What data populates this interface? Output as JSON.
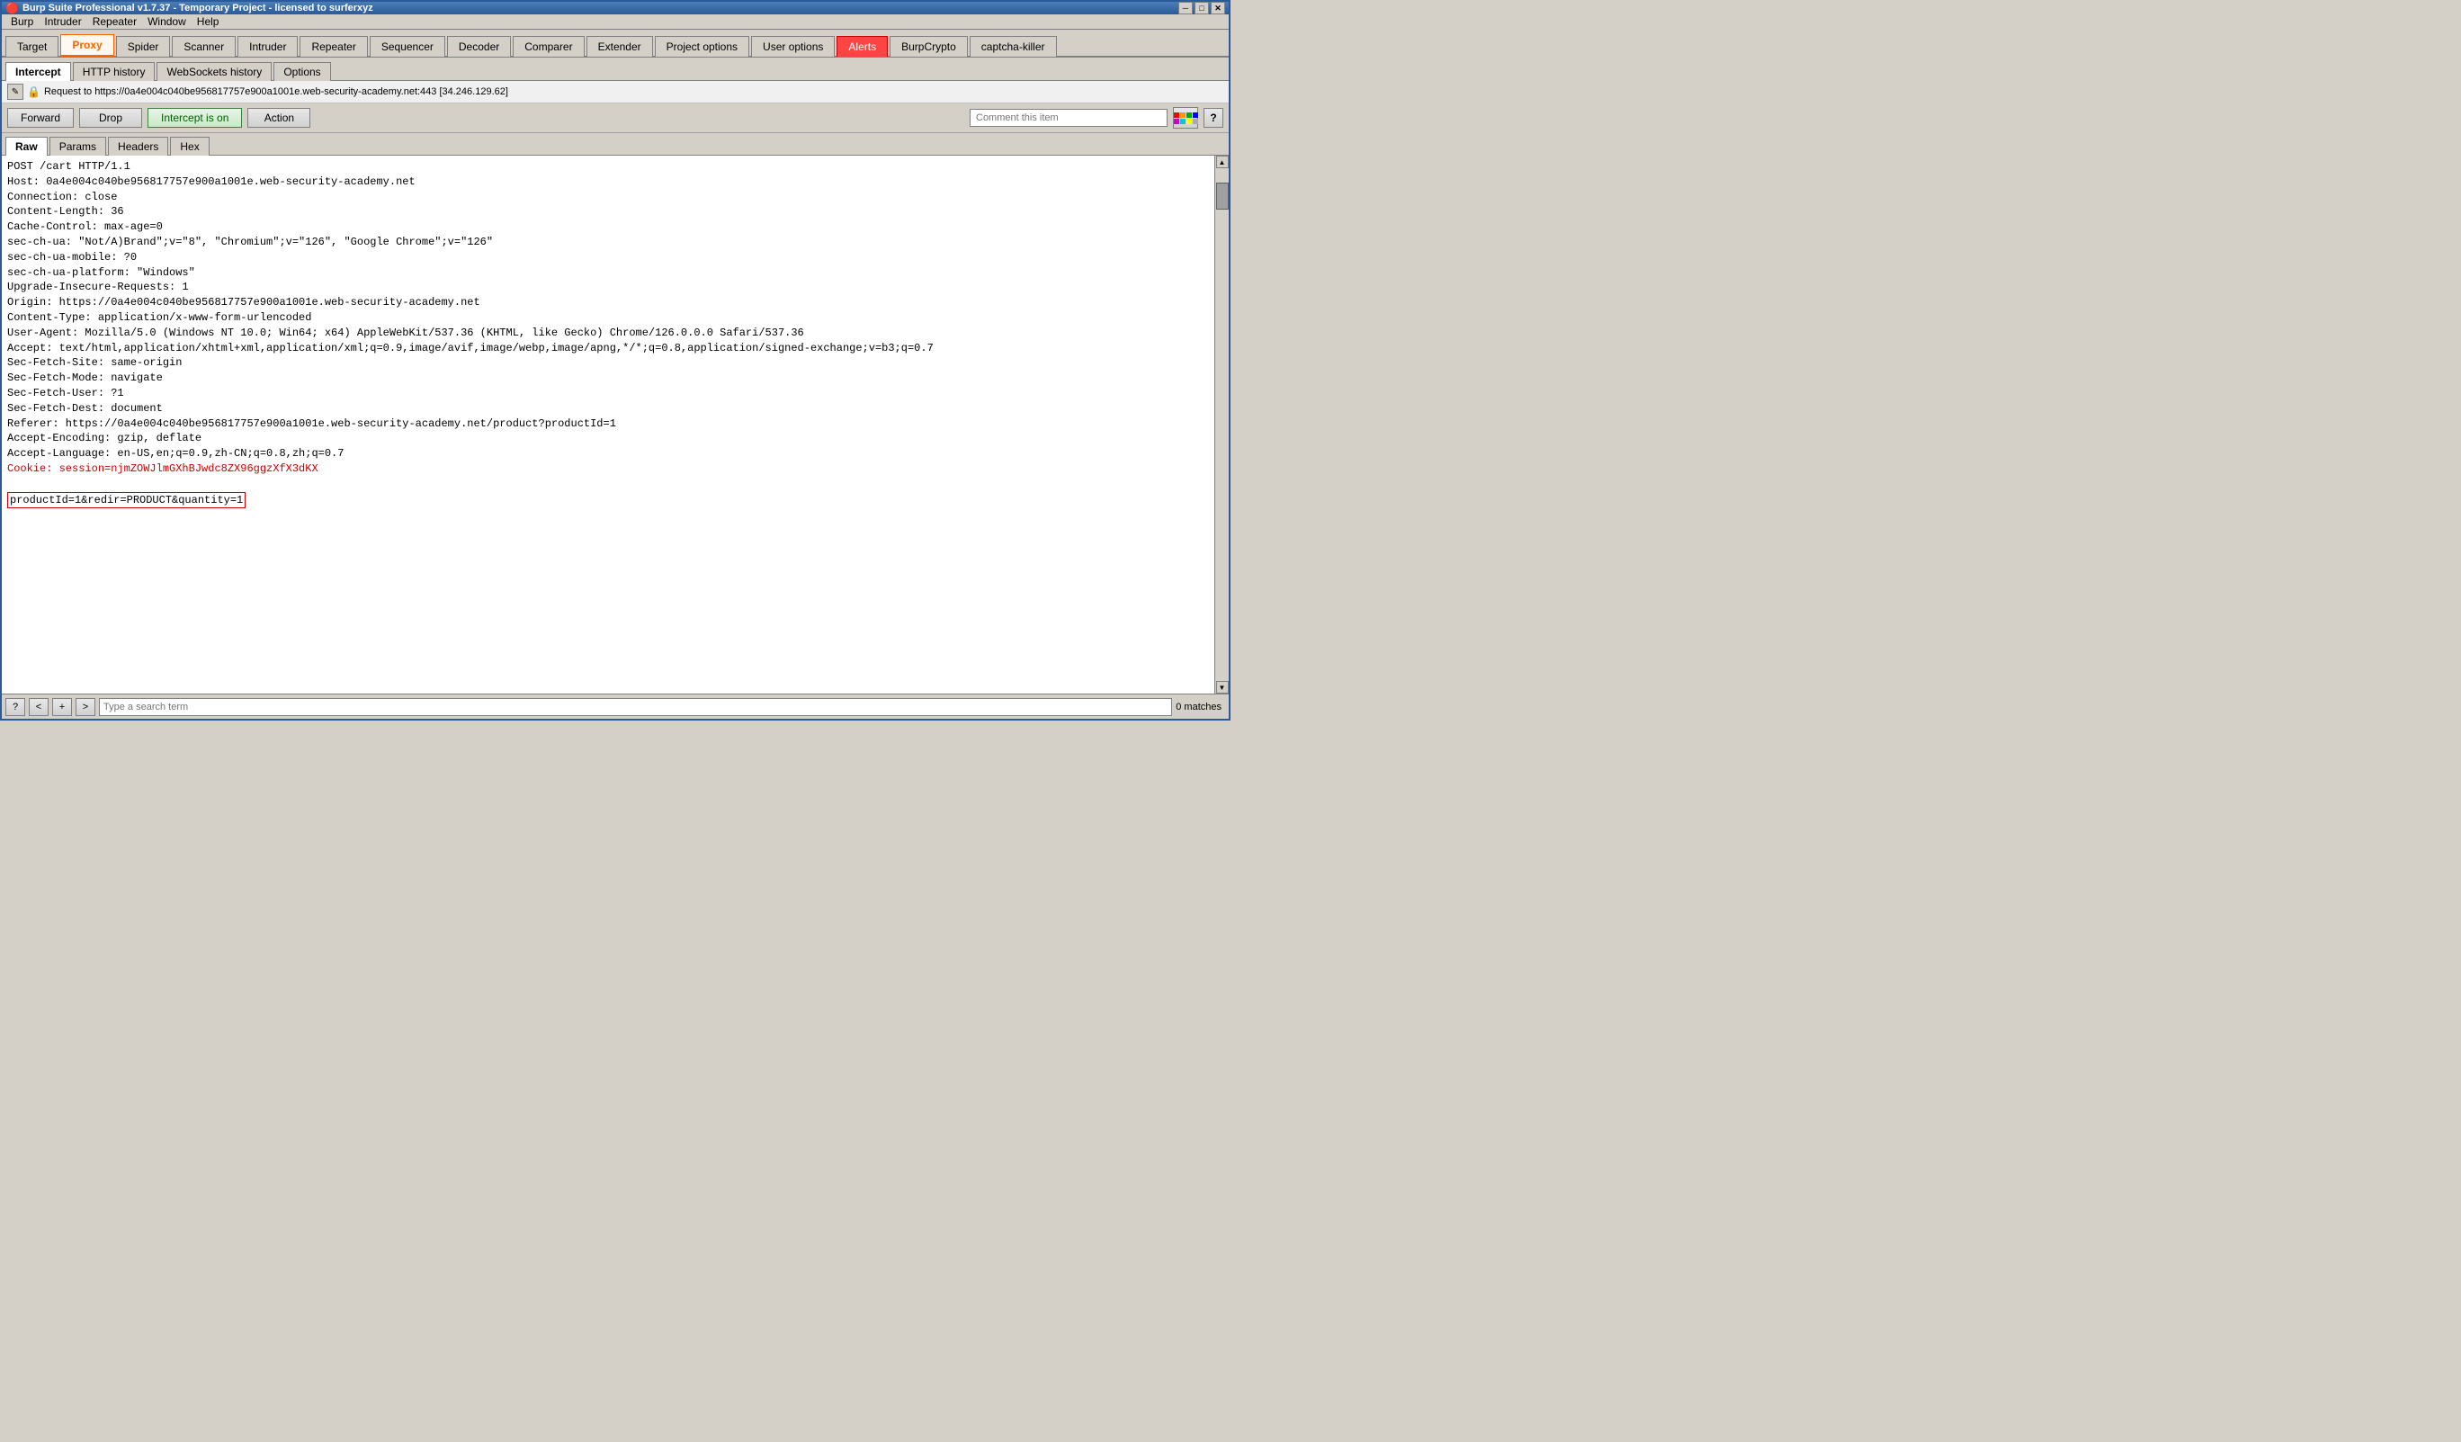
{
  "titleBar": {
    "title": "Burp Suite Professional v1.7.37 - Temporary Project - licensed to surferxyz",
    "minimize": "─",
    "maximize": "□",
    "close": "✕"
  },
  "menuBar": {
    "items": [
      "Burp",
      "Intruder",
      "Repeater",
      "Window",
      "Help"
    ]
  },
  "mainTabs": {
    "tabs": [
      "Target",
      "Proxy",
      "Spider",
      "Scanner",
      "Intruder",
      "Repeater",
      "Sequencer",
      "Decoder",
      "Comparer",
      "Extender",
      "Project options",
      "User options",
      "Alerts",
      "BurpCrypto",
      "captcha-killer"
    ],
    "active": "Proxy"
  },
  "subTabs": {
    "tabs": [
      "Intercept",
      "HTTP history",
      "WebSockets history",
      "Options"
    ],
    "active": "Intercept"
  },
  "infoBar": {
    "text": "Request to https://0a4e004c040be956817757e900a1001e.web-security-academy.net:443  [34.246.129.62]"
  },
  "toolbar": {
    "forward": "Forward",
    "drop": "Drop",
    "interceptOn": "Intercept is on",
    "action": "Action",
    "commentPlaceholder": "Comment this item"
  },
  "contentTabs": {
    "tabs": [
      "Raw",
      "Params",
      "Headers",
      "Hex"
    ],
    "active": "Raw"
  },
  "requestBody": {
    "headers": "POST /cart HTTP/1.1\nHost: 0a4e004c040be956817757e900a1001e.web-security-academy.net\nConnection: close\nContent-Length: 36\nCache-Control: max-age=0\nsec-ch-ua: \"Not/A)Brand\";v=\"8\", \"Chromium\";v=\"126\", \"Google Chrome\";v=\"126\"\nsec-ch-ua-mobile: ?0\nsec-ch-ua-platform: \"Windows\"\nUpgrade-Insecure-Requests: 1\nOrigin: https://0a4e004c040be956817757e900a1001e.web-security-academy.net\nContent-Type: application/x-www-form-urlencoded\nUser-Agent: Mozilla/5.0 (Windows NT 10.0; Win64; x64) AppleWebKit/537.36 (KHTML, like Gecko) Chrome/126.0.0.0 Safari/537.36\nAccept: text/html,application/xhtml+xml,application/xml;q=0.9,image/avif,image/webp,image/apng,*/*;q=0.8,application/signed-exchange;v=b3;q=0.7\nSec-Fetch-Site: same-origin\nSec-Fetch-Mode: navigate\nSec-Fetch-User: ?1\nSec-Fetch-Dest: document\nReferer: https://0a4e004c040be956817757e900a1001e.web-security-academy.net/product?productId=1\nAccept-Encoding: gzip, deflate\nAccept-Language: en-US,en;q=0.9,zh-CN;q=0.8,zh;q=0.7",
    "cookieLine": "Cookie: session=njmZOWJlmGXhBJwdc8ZX96ggzXfX3dKX",
    "bodyLine": "productId=1&redir=PRODUCT&quantity=1"
  },
  "bottomBar": {
    "helpLabel": "?",
    "prevLabel": "<",
    "addLabel": "+",
    "nextLabel": ">",
    "searchPlaceholder": "Type a search term",
    "matchesLabel": "0 matches"
  },
  "colors": {
    "activeTab": "#ffffff",
    "orange": "#ff6600",
    "alertsRed": "#cc0000",
    "interceptGreen": "#006000",
    "cookieRed": "#cc0000"
  }
}
